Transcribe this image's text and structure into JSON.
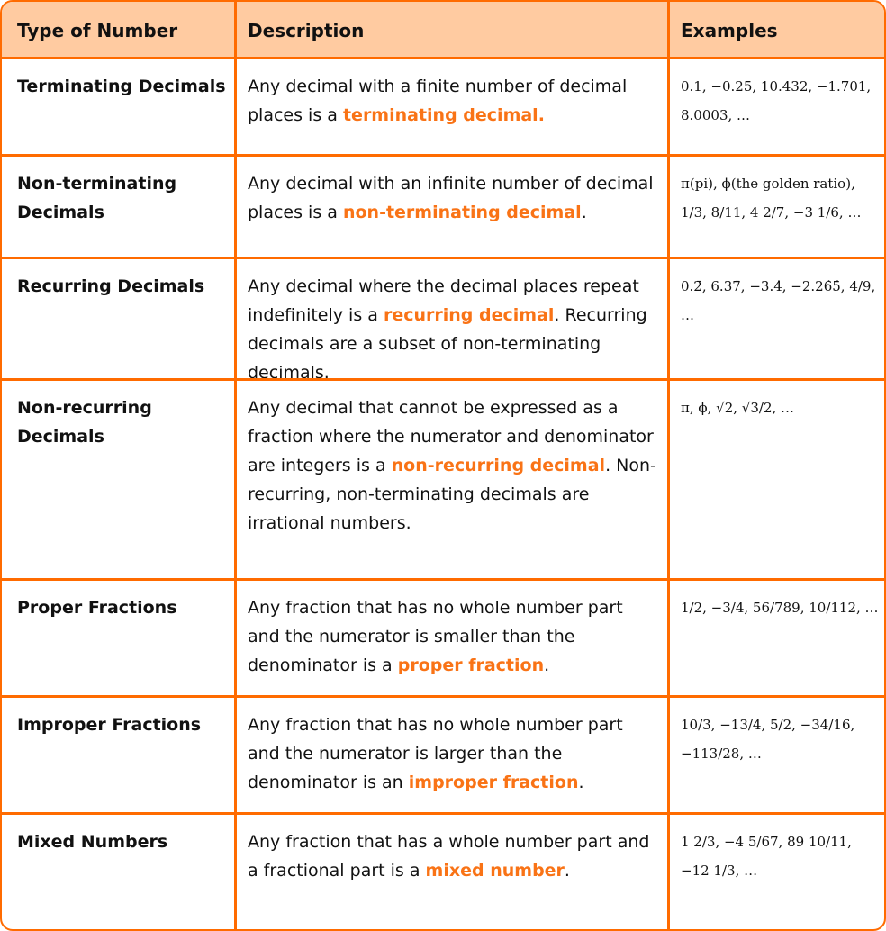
{
  "header": {
    "col1": "Type of Number",
    "col2": "Description",
    "col3": "Examples"
  },
  "accent": "#FF6B00",
  "rows": [
    {
      "type": "Terminating Decimals",
      "desc_pre": "Any decimal with a finite number of decimal places is a ",
      "desc_hl": "terminating decimal.",
      "desc_post": "",
      "examples": "0.1,  −0.25,  10.432,  −1.701,  8.0003, …"
    },
    {
      "type": "Non-terminating Decimals",
      "desc_pre": "Any decimal with an infinite number of decimal places is a ",
      "desc_hl": "non-terminating decimal",
      "desc_post": ".",
      "examples": "π(pi),  ϕ(the golden ratio),  1/3,  8/11,  4 2/7,  −3 1/6, …"
    },
    {
      "type": "Recurring Decimals",
      "desc_pre": "Any decimal where the decimal places repeat indefinitely is a ",
      "desc_hl": "recurring decimal",
      "desc_post": ". Recurring decimals are a subset of non-terminating decimals.",
      "examples": "0.2̄,  6.37̄,  −3.4̇,  −2.26̇5̇,  4/9, …"
    },
    {
      "type": "Non-recurring Decimals",
      "desc_pre": "Any decimal that cannot be expressed as a fraction where the numerator and denominator are integers is a ",
      "desc_hl": "non-recurring decimal",
      "desc_post": ". Non-recurring, non-terminating decimals are irrational numbers.",
      "examples": "π,  ϕ,  √2,  √3/2, …"
    },
    {
      "type": "Proper Fractions",
      "desc_pre": "Any fraction that has no whole number part and the numerator is smaller than the denominator is a ",
      "desc_hl": "proper fraction",
      "desc_post": ".",
      "examples": "1/2,  −3/4,  56/789,  10/112, …"
    },
    {
      "type": "Improper Fractions",
      "desc_pre": "Any fraction that has no whole number part and the numerator is larger than the denominator is an ",
      "desc_hl": "improper fraction",
      "desc_post": ".",
      "examples": "10/3,  −13/4,  5/2,  −34/16,  −113/28, …"
    },
    {
      "type": "Mixed Numbers",
      "desc_pre": "Any fraction that has a whole number part and a fractional part is a ",
      "desc_hl": "mixed number",
      "desc_post": ".",
      "examples": "1 2/3,  −4 5/67,  89 10/11,  −12 1/3, …"
    }
  ]
}
